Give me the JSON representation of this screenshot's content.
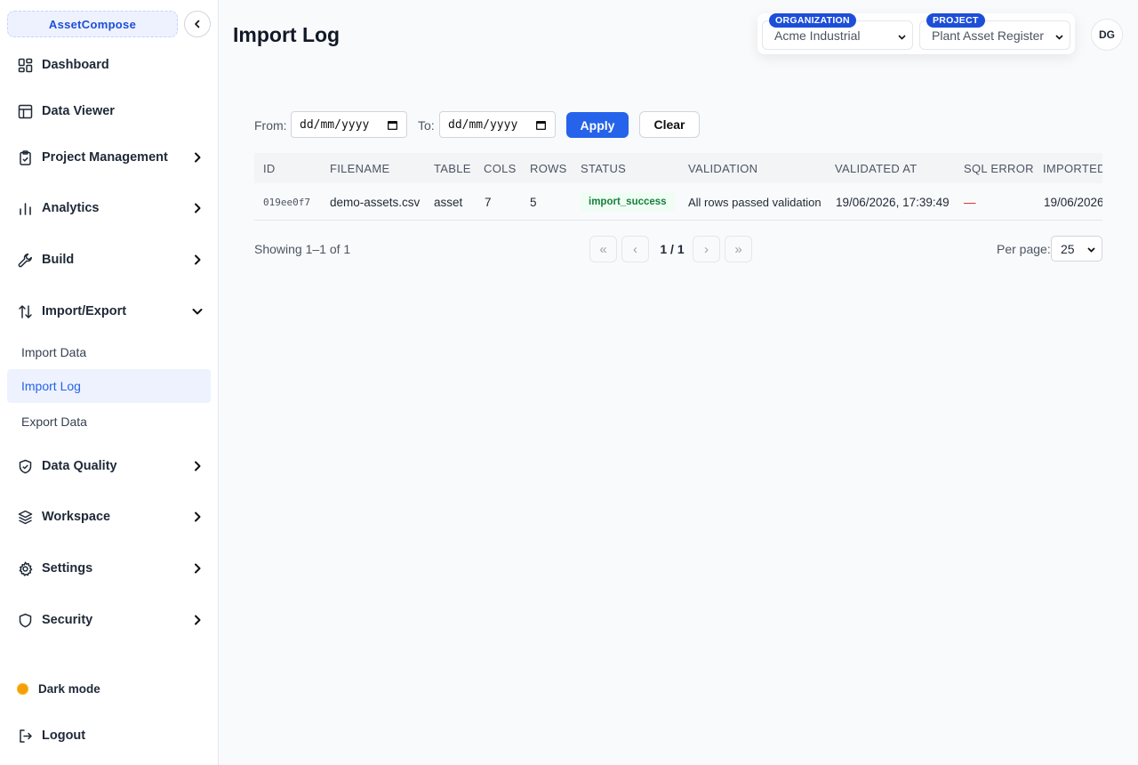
{
  "app": {
    "brand": "AssetCompose",
    "page_title": "Import Log"
  },
  "sidebar": {
    "items": [
      {
        "label": "Dashboard",
        "icon": "dashboard-icon"
      },
      {
        "label": "Data Viewer",
        "icon": "table-icon"
      },
      {
        "label": "Project Management",
        "icon": "clipboard-icon"
      },
      {
        "label": "Analytics",
        "icon": "bar-chart-icon"
      },
      {
        "label": "Build",
        "icon": "wrench-icon"
      },
      {
        "label": "Import/Export",
        "icon": "arrows-up-down-icon"
      },
      {
        "label": "Data Quality",
        "icon": "shield-check-icon"
      },
      {
        "label": "Workspace",
        "icon": "layers-icon"
      },
      {
        "label": "Settings",
        "icon": "gear-icon"
      },
      {
        "label": "Security",
        "icon": "shield-icon"
      }
    ],
    "sub_items": [
      "Import Data",
      "Import Log",
      "Export Data"
    ],
    "dark_mode": "Dark mode",
    "logout": "Logout"
  },
  "context": {
    "organization_label": "ORGANIZATION",
    "organization_value": "Acme Industrial",
    "project_label": "PROJECT",
    "project_value": "Plant Asset Register",
    "user_initials": "DG"
  },
  "filters": {
    "from_label": "From:",
    "from_placeholder": "dd/mm/yyyy",
    "to_label": "To:",
    "to_placeholder": "dd/mm/yyyy",
    "apply": "Apply",
    "clear": "Clear"
  },
  "table": {
    "columns": [
      "ID",
      "FILENAME",
      "TABLE",
      "COLS",
      "ROWS",
      "STATUS",
      "VALIDATION",
      "VALIDATED AT",
      "SQL ERROR",
      "IMPORTED"
    ],
    "rows": [
      {
        "id": "019ee0f7",
        "filename": "demo-assets.csv",
        "table": "asset",
        "cols": "7",
        "rows": "5",
        "status": "import_success",
        "validation": "All rows passed validation",
        "validated_at": "19/06/2026, 17:39:49",
        "sql_error": "—",
        "imported": "19/06/2026"
      }
    ]
  },
  "pagination": {
    "showing": "Showing 1–1 of 1",
    "first": "«",
    "prev": "‹",
    "page": "1 / 1",
    "next": "›",
    "last": "»",
    "per_page_label": "Per page:",
    "per_page_value": "25"
  },
  "colors": {
    "accent": "#2563eb",
    "success": "#15803d",
    "brand_bg": "#eef2ff"
  }
}
